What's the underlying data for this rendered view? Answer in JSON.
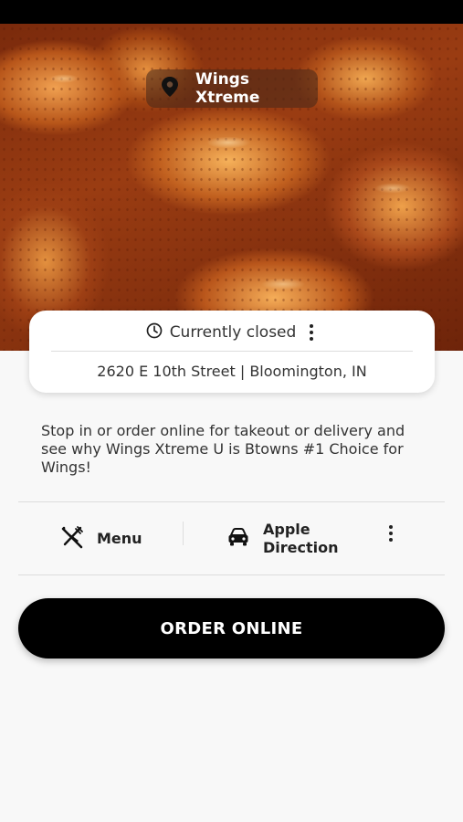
{
  "restaurant": {
    "name": "Wings Xtreme",
    "status": "Currently closed",
    "address": "2620 E 10th Street  | Bloomington, IN",
    "description": "Stop in or order online for takeout or delivery and see why Wings Xtreme U is Btowns #1 Choice for Wings!"
  },
  "hero": {
    "image_subject": "glazed chicken wings"
  },
  "icons": {
    "location": "map-pin-icon",
    "status": "clock-icon",
    "status_more": "more-vertical-icon",
    "menu": "utensils-icon",
    "direction": "car-icon",
    "actions_more": "more-vertical-icon"
  },
  "actions": {
    "menu_label": "Menu",
    "direction_label_line1": "Apple",
    "direction_label_line2": "Direction"
  },
  "cta": {
    "order_label": "ORDER ONLINE"
  },
  "colors": {
    "background": "#f8f8f8",
    "cta_background": "#000000",
    "cta_text": "#ffffff",
    "card_background": "#ffffff"
  }
}
